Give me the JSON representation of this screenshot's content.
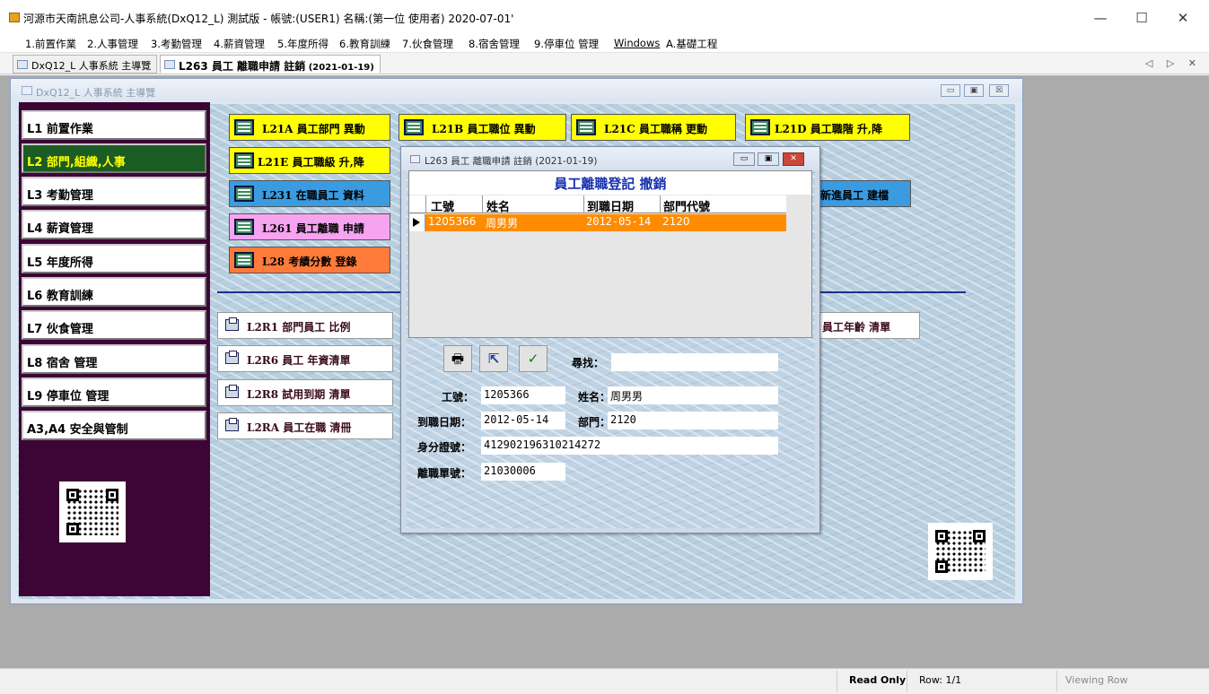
{
  "window": {
    "title": "河源市天南訊息公司-人事系統(DxQ12_L) 測試版 - 帳號:(USER1) 名稱:(第一位 使用者) 2020-07-01'",
    "minimize": "—",
    "maximize": "☐",
    "close": "✕"
  },
  "menu": [
    "1.前置作業",
    "2.人事管理",
    "3.考勤管理",
    "4.薪資管理",
    "5.年度所得",
    "6.教育訓練",
    "7.伙食管理",
    "8.宿舍管理",
    "9.停車位 管理",
    "Windows",
    "A.基礎工程"
  ],
  "tabs": [
    {
      "label": "DxQ12_L 人事系統 主導覽"
    },
    {
      "label": "L263 員工 離職申請 註銷",
      "suffix": "(2021-01-19)"
    }
  ],
  "tab_nav": "◁ ▷ ✕",
  "child_window": {
    "title": "DxQ12_L 人事系統 主導覽",
    "btn_min": "▭",
    "btn_restore": "▣",
    "btn_close": "☒"
  },
  "sidebar": [
    {
      "label": "L1 前置作業"
    },
    {
      "label": "L2 部門,組織,人事",
      "active": true
    },
    {
      "label": "L3 考勤管理"
    },
    {
      "label": "L4 薪資管理"
    },
    {
      "label": "L5 年度所得"
    },
    {
      "label": "L6 教育訓練"
    },
    {
      "label": "L7 伙食管理"
    },
    {
      "label": "L8 宿舍 管理"
    },
    {
      "label": "L9 停車位 管理"
    },
    {
      "label": "A3,A4 安全與管制"
    }
  ],
  "buttons": {
    "l21a": "L21A 員工部門 異動",
    "l21b": "L21B 員工職位 異動",
    "l21c": "L21C 員工職稱 更動",
    "l21d": "L21D 員工職階 升,降",
    "l21e": "L21E 員工職級 升,降",
    "l231": "L231 在職員工 資料",
    "l24_partial": "新進員工 建檔",
    "l261": "L261 員工離職 申請",
    "l28": "L28 考績分數 登錄"
  },
  "reports": {
    "l2r1": "L2R1 部門員工 比例",
    "l2r6": "L2R6 員工 年資清單",
    "l2r8": "L2R8 試用到期 清單",
    "l2ra": "L2RA 員工在職 清冊",
    "r_partial": "員工年齡 清單"
  },
  "colors": {
    "sidebar_bg": "#3d0535",
    "active_side": "#1b5b24",
    "yellow_btn": "#ffff00",
    "blue_btn": "#3a9be0",
    "pink_btn": "#f6a3f0",
    "orange_btn": "#ff7b3a",
    "row_highlight": "#ff8c00"
  },
  "dialog": {
    "title": "L263 員工 離職申請 註銷 (2021-01-19)",
    "heading": "員工離職登記 撤銷",
    "columns": [
      "工號",
      "姓名",
      "到職日期",
      "部門代號"
    ],
    "rows": [
      {
        "id": "1205366",
        "name": "周男男",
        "start": "2012-05-14",
        "dept": "2120"
      }
    ],
    "search_label": "尋找：",
    "search_value": "",
    "fields": {
      "id_label": "工號：",
      "id_value": "1205366",
      "name_label": "姓名：",
      "name_value": "周男男",
      "start_label": "到職日期：",
      "start_value": "2012-05-14",
      "dept_label": "部門：",
      "dept_value": "2120",
      "idcard_label": "身分證號：",
      "idcard_value": "412902196310214272",
      "resign_label": "離職單號：",
      "resign_value": "21030006"
    },
    "btn_min": "▭",
    "btn_restore": "▣",
    "btn_close": "✕"
  },
  "statusbar": {
    "readonly": "Read Only",
    "row": "Row: 1/1",
    "mode": "Viewing Row"
  }
}
